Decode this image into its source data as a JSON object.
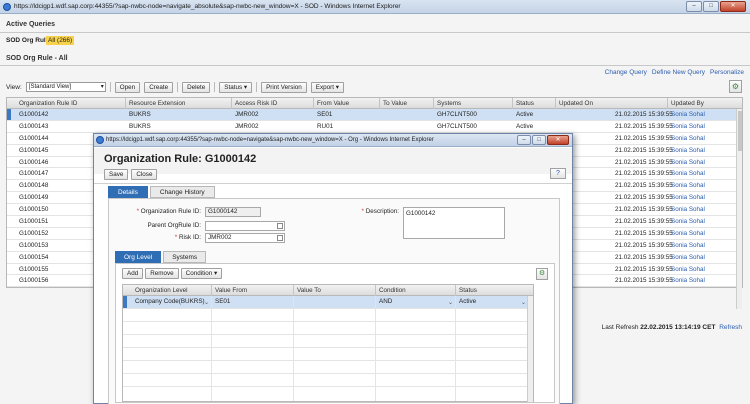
{
  "browser": {
    "title": "https://ldcigp1.wdf.sap.corp:44355/?sap-nwbc-node=navigate_absolute&sap-nwbc-new_window=X - SOD - Windows Internet Explorer",
    "min": "–",
    "max": "□",
    "close": "✕"
  },
  "active_queries": {
    "title": "Active Queries",
    "label": "SOD Org Rule",
    "value": "All (266)"
  },
  "section": {
    "title": "SOD Org Rule - All"
  },
  "query_links": [
    "Change Query",
    "Define New Query",
    "Personalize"
  ],
  "toolbar": {
    "view_label": "View:",
    "view_value": "[Standard View]",
    "buttons": [
      "Open",
      "Create",
      "Delete",
      "Status ▾",
      "Print Version",
      "Export ▾"
    ]
  },
  "table": {
    "columns": [
      "Organization Rule ID",
      "Resource Extension",
      "Access Risk ID",
      "From Value",
      "To Value",
      "Systems",
      "Status",
      "Updated On",
      "Updated By"
    ],
    "rows": [
      [
        "G1000142",
        "BUKRS",
        "JMR002",
        "SE01",
        "",
        "GH7CLNT500",
        "Active",
        "21.02.2015 15:39:55",
        "Sonia Sohal"
      ],
      [
        "G1000143",
        "BUKRS",
        "JMR002",
        "RU01",
        "",
        "GH7CLNT500",
        "Active",
        "21.02.2015 15:39:55",
        "Sonia Sohal"
      ],
      [
        "G1000144",
        "",
        "",
        "",
        "",
        "",
        "",
        "21.02.2015 15:39:55",
        "Sonia Sohal"
      ],
      [
        "G1000145",
        "",
        "",
        "",
        "",
        "",
        "",
        "21.02.2015 15:39:55",
        "Sonia Sohal"
      ],
      [
        "G1000146",
        "",
        "",
        "",
        "",
        "",
        "",
        "21.02.2015 15:39:55",
        "Sonia Sohal"
      ],
      [
        "G1000147",
        "",
        "",
        "",
        "",
        "",
        "",
        "21.02.2015 15:39:55",
        "Sonia Sohal"
      ],
      [
        "G1000148",
        "",
        "",
        "",
        "",
        "",
        "",
        "21.02.2015 15:39:55",
        "Sonia Sohal"
      ],
      [
        "G1000149",
        "",
        "",
        "",
        "",
        "",
        "",
        "21.02.2015 15:39:55",
        "Sonia Sohal"
      ],
      [
        "G1000150",
        "",
        "",
        "",
        "",
        "",
        "",
        "21.02.2015 15:39:55",
        "Sonia Sohal"
      ],
      [
        "G1000151",
        "",
        "",
        "",
        "",
        "",
        "",
        "21.02.2015 15:39:55",
        "Sonia Sohal"
      ],
      [
        "G1000152",
        "",
        "",
        "",
        "",
        "",
        "",
        "21.02.2015 15:39:55",
        "Sonia Sohal"
      ],
      [
        "G1000153",
        "",
        "",
        "",
        "",
        "",
        "",
        "21.02.2015 15:39:55",
        "Sonia Sohal"
      ],
      [
        "G1000154",
        "",
        "",
        "",
        "",
        "",
        "",
        "21.02.2015 15:39:55",
        "Sonia Sohal"
      ],
      [
        "G1000155",
        "",
        "",
        "",
        "",
        "",
        "",
        "21.02.2015 15:39:55",
        "Sonia Sohal"
      ],
      [
        "G1000156",
        "",
        "",
        "",
        "",
        "",
        "",
        "21.02.2015 15:39:55",
        "Sonia Sohal"
      ]
    ]
  },
  "last_refresh": {
    "label": "Last Refresh",
    "value": "22.02.2015 13:14:19 CET",
    "link": "Refresh"
  },
  "popup": {
    "title": "https://ldcigp1.wdf.sap.corp:44355/?sap-nwbc-node=navigate&sap-nwbc-new_window=X - Org - Windows Internet Explorer",
    "heading": "Organization Rule: G1000142",
    "buttons": [
      "Save",
      "Close"
    ],
    "help": "?",
    "tabs": [
      "Details",
      "Change History"
    ],
    "fields": {
      "org_rule_id_label": "Organization Rule ID:",
      "org_rule_id_value": "G1000142",
      "parent_label": "Parent OrgRule ID:",
      "parent_value": "",
      "risk_label": "Risk ID:",
      "risk_value": "JMR002",
      "desc_label": "Description:",
      "desc_value": "G1000142"
    },
    "subtabs": [
      "Org Level",
      "Systems"
    ],
    "sub_buttons": [
      "Add",
      "Remove",
      "Condition ▾"
    ],
    "sub_columns": [
      "Organization Level",
      "Value From",
      "Value To",
      "Condition",
      "Status"
    ],
    "sub_rows": [
      [
        "Company Code(BUKRS)",
        "SE01",
        "",
        "AND",
        "Active"
      ]
    ]
  },
  "icons": {
    "personalize": "person-settings-icon",
    "value_help": "value-help-icon"
  },
  "colors": {
    "accent": "#2f6eb5",
    "selection": "#cfe0f4",
    "highlight": "#f7d24a",
    "link": "#2a5db0"
  }
}
